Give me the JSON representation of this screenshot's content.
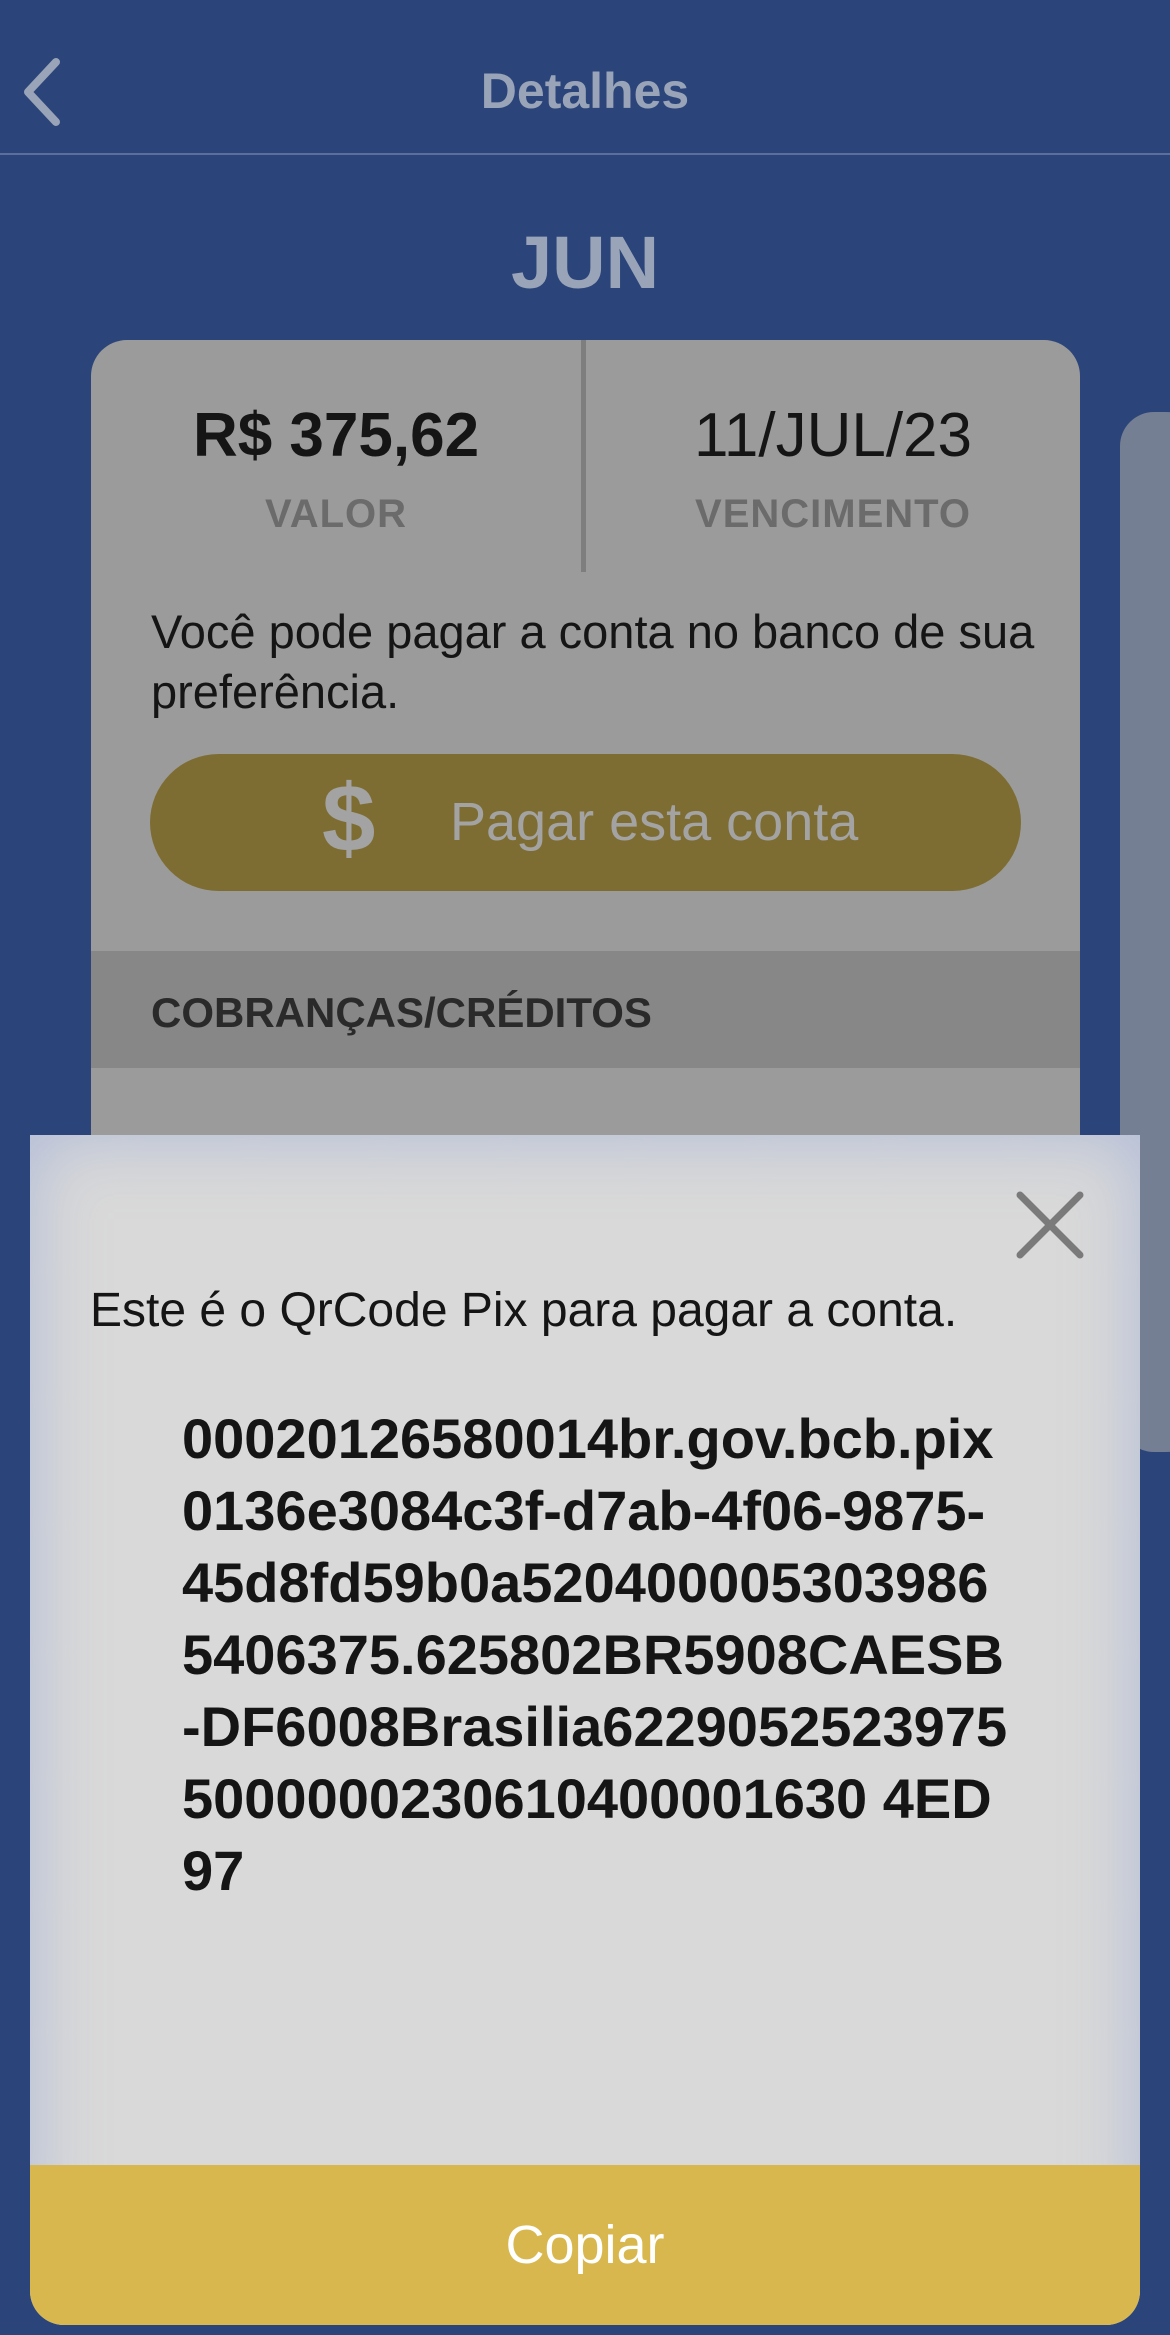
{
  "header": {
    "title": "Detalhes",
    "back_icon": "chevron-left-icon"
  },
  "month": "JUN",
  "bill": {
    "amount": "R$ 375,62",
    "amount_label": "VALOR",
    "due_date": "11/JUL/23",
    "due_label": "VENCIMENTO",
    "info_text": "Você pode pagar a conta no banco de sua preferência.",
    "pay_button": {
      "icon": "$",
      "label": "Pagar esta conta"
    },
    "section_title": "COBRANÇAS/CRÉDITOS"
  },
  "modal": {
    "close_icon": "close-icon",
    "text": "Este é o QrCode Pix para pagar a conta.",
    "pix_code": "00020126580014br.gov.bcb.pix0136e3084c3f-d7ab-4f06-9875-45d8fd59b0a5204000053039865406375.625802BR5908CAESB-DF6008Brasilia62290525239755000000230610400001630 4ED97",
    "copy_button": "Copiar"
  },
  "colors": {
    "background": "#2b4479",
    "pay_button": "#7e6d33",
    "copy_button": "#d8b84e"
  }
}
